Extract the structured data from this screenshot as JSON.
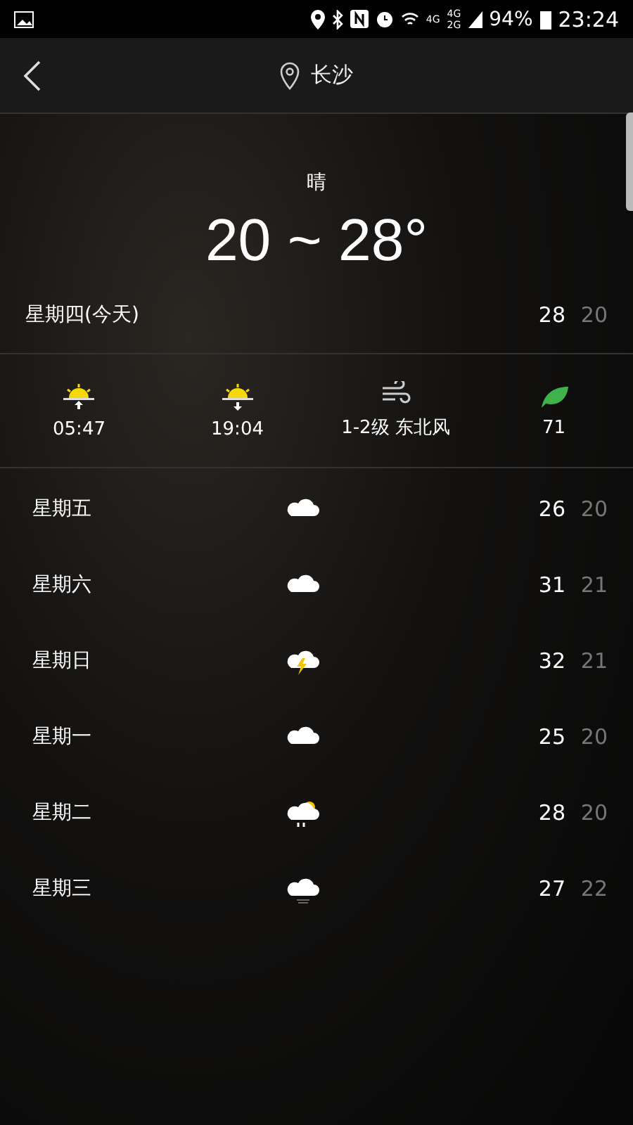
{
  "status_bar": {
    "battery": "94%",
    "time": "23:24",
    "network_1": "4G",
    "network_2": "4G",
    "network_3": "2G"
  },
  "header": {
    "city": "长沙"
  },
  "current": {
    "condition": "晴",
    "range": "20 ~ 28°"
  },
  "today": {
    "day": "星期四(今天)",
    "high": "28",
    "low": "20"
  },
  "details": [
    {
      "kind": "sunrise",
      "value": "05:47"
    },
    {
      "kind": "sunset",
      "value": "19:04"
    },
    {
      "kind": "wind",
      "value": "1-2级 东北风"
    },
    {
      "kind": "air",
      "value": "71"
    }
  ],
  "forecast": [
    {
      "day": "星期五",
      "kind": "cloudy",
      "high": "26",
      "low": "20"
    },
    {
      "day": "星期六",
      "kind": "cloudy",
      "high": "31",
      "low": "21"
    },
    {
      "day": "星期日",
      "kind": "thunder",
      "high": "32",
      "low": "21"
    },
    {
      "day": "星期一",
      "kind": "cloudy",
      "high": "25",
      "low": "20"
    },
    {
      "day": "星期二",
      "kind": "sunrain",
      "high": "28",
      "low": "20"
    },
    {
      "day": "星期三",
      "kind": "haze",
      "high": "27",
      "low": "22"
    }
  ]
}
